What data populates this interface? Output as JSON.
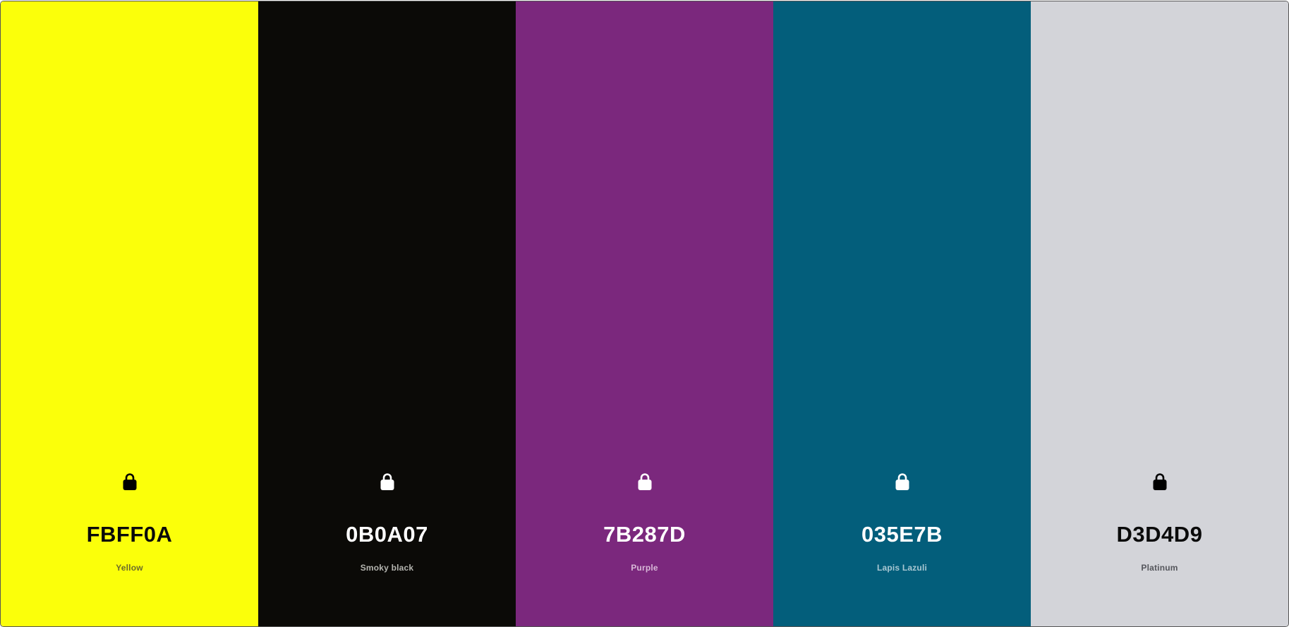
{
  "palette": {
    "colors": [
      {
        "hex": "FBFF0A",
        "name": "Yellow",
        "color": "#FBFF0A",
        "text_color": "#0a0a0a",
        "name_color": "#6b6b2a",
        "lock_color": "#000000"
      },
      {
        "hex": "0B0A07",
        "name": "Smoky black",
        "color": "#0B0A07",
        "text_color": "#ffffff",
        "name_color": "#b5b5b0",
        "lock_color": "#ffffff"
      },
      {
        "hex": "7B287D",
        "name": "Purple",
        "color": "#7B287D",
        "text_color": "#ffffff",
        "name_color": "#d8b9d8",
        "lock_color": "#ffffff"
      },
      {
        "hex": "035E7B",
        "name": "Lapis Lazuli",
        "color": "#035E7B",
        "text_color": "#ffffff",
        "name_color": "#a9c8d3",
        "lock_color": "#ffffff"
      },
      {
        "hex": "D3D4D9",
        "name": "Platinum",
        "color": "#D3D4D9",
        "text_color": "#0a0a0a",
        "name_color": "#55565c",
        "lock_color": "#000000"
      }
    ]
  }
}
